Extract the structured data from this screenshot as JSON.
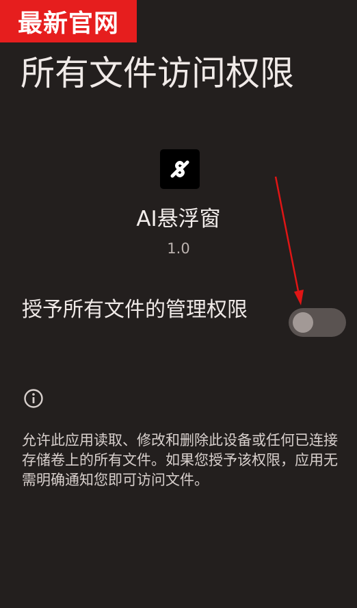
{
  "watermark": {
    "text": "最新官网"
  },
  "page": {
    "title": "所有文件访问权限"
  },
  "app": {
    "icon": "app-logo-icon",
    "name": "AI悬浮窗",
    "version": "1.0"
  },
  "setting": {
    "label": "授予所有文件的管理权限",
    "enabled": false
  },
  "info": {
    "icon": "info-icon",
    "description": "允许此应用读取、修改和删除此设备或任何已连接存储卷上的所有文件。如果您授予该权限，应用无需明确通知您即可访问文件。"
  },
  "colors": {
    "background": "#231f1e",
    "watermark": "#e61e1e",
    "annotation_arrow": "#e01515",
    "toggle_track_off": "#5a5351",
    "toggle_thumb_off": "#a29996"
  }
}
